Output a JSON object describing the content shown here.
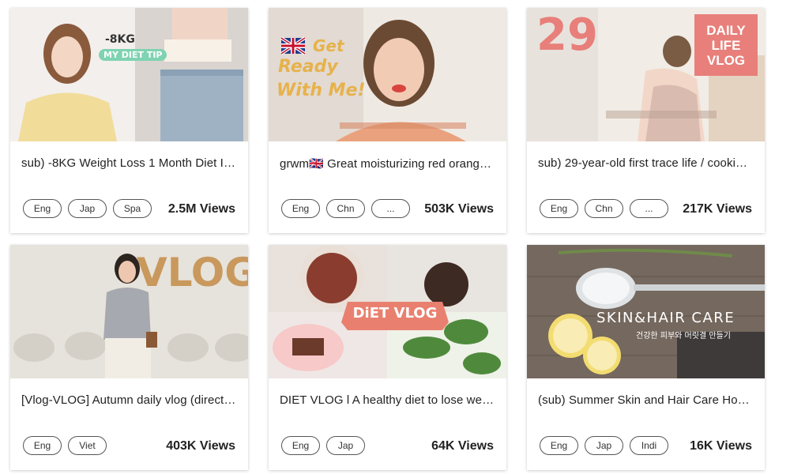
{
  "videos": [
    {
      "title": "sub) -8KG Weight Loss 1 Month Diet In…",
      "tags": [
        "Eng",
        "Jap",
        "Spa"
      ],
      "views": "2.5M Views",
      "thumb_texts": [
        "-8KG",
        "MY DIET TIP"
      ]
    },
    {
      "title": "grwm🇬🇧 Great moisturizing red orange…",
      "tags": [
        "Eng",
        "Chn",
        "..."
      ],
      "views": "503K Views",
      "thumb_texts": [
        "Get",
        "Ready",
        "With Me!"
      ]
    },
    {
      "title": "sub) 29-year-old first trace life / cooki…",
      "tags": [
        "Eng",
        "Chn",
        "..."
      ],
      "views": "217K Views",
      "thumb_texts": [
        "29",
        "DAILY",
        "LIFE",
        "VLOG"
      ]
    },
    {
      "title": "[Vlog-VLOG] Autumn daily vlog (directi…",
      "tags": [
        "Eng",
        "Viet"
      ],
      "views": "403K Views",
      "thumb_texts": [
        "VLOG"
      ]
    },
    {
      "title": "DIET VLOG l A healthy diet to lose weig…",
      "tags": [
        "Eng",
        "Jap"
      ],
      "views": "64K Views",
      "thumb_texts": [
        "DiET VLOG"
      ]
    },
    {
      "title": "(sub) Summer Skin and Hair Care How…",
      "tags": [
        "Eng",
        "Jap",
        "Indi"
      ],
      "views": "16K Views",
      "thumb_texts": [
        "SKIN&HAIR CARE",
        "건강한 피부와 머릿결 만들기"
      ]
    }
  ]
}
